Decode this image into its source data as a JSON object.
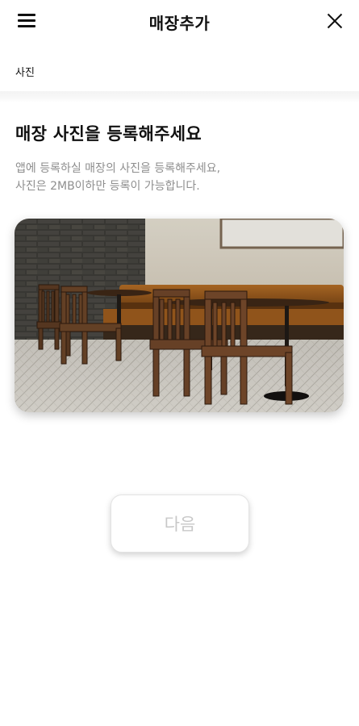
{
  "header": {
    "title": "매장추가",
    "menu_icon": "hamburger-menu-icon",
    "close_icon": "close-icon"
  },
  "breadcrumb": {
    "label": "사진"
  },
  "section": {
    "title": "매장 사진을 등록해주세요",
    "description_line1": "앱에 등록하실 매장의 사진을 등록해주세요,",
    "description_line2": "사진은 2MB이하만 등록이 가능합니다."
  },
  "photo": {
    "subject": "cafe-interior-photo"
  },
  "actions": {
    "next_label": "다음",
    "next_enabled": false
  },
  "colors": {
    "text_primary": "#111111",
    "text_secondary": "#8e8e8e",
    "button_disabled_text": "#c8c8c8"
  }
}
